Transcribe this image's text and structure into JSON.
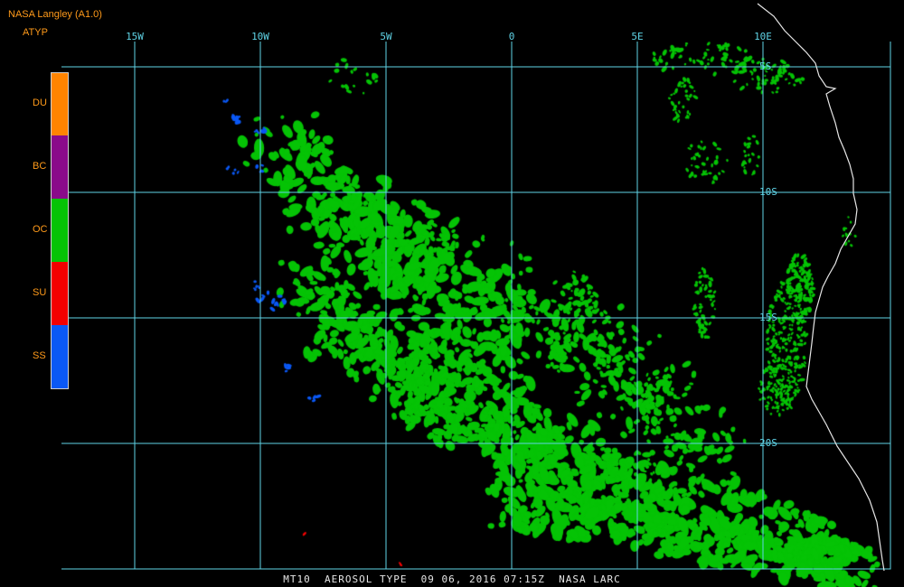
{
  "header": {
    "title": "NASA Langley (A1.0)",
    "variable": "ATYP"
  },
  "legend": [
    {
      "code": "DU",
      "color": "#ff8400"
    },
    {
      "code": "BC",
      "color": "#8a0a8a"
    },
    {
      "code": "OC",
      "color": "#05c305"
    },
    {
      "code": "SU",
      "color": "#f30000"
    },
    {
      "code": "SS",
      "color": "#0a58f5"
    }
  ],
  "grid": {
    "longitudes": [
      {
        "value": -15,
        "label": "15W"
      },
      {
        "value": -10,
        "label": "10W"
      },
      {
        "value": -5,
        "label": "5W"
      },
      {
        "value": 0,
        "label": "0"
      },
      {
        "value": 5,
        "label": "5E"
      },
      {
        "value": 10,
        "label": "10E"
      }
    ],
    "latitudes": [
      {
        "value": -5,
        "label": "5S"
      },
      {
        "value": -10,
        "label": "10S"
      },
      {
        "value": -15,
        "label": "15S"
      },
      {
        "value": -20,
        "label": "20S"
      }
    ],
    "color": "#5fd3e6"
  },
  "map": {
    "coastline_color": "#e6e6e6",
    "background": "#000000"
  },
  "footer": {
    "text": "MT10  AEROSOL TYPE  09 06, 2016 07:15Z  NASA LARC"
  }
}
